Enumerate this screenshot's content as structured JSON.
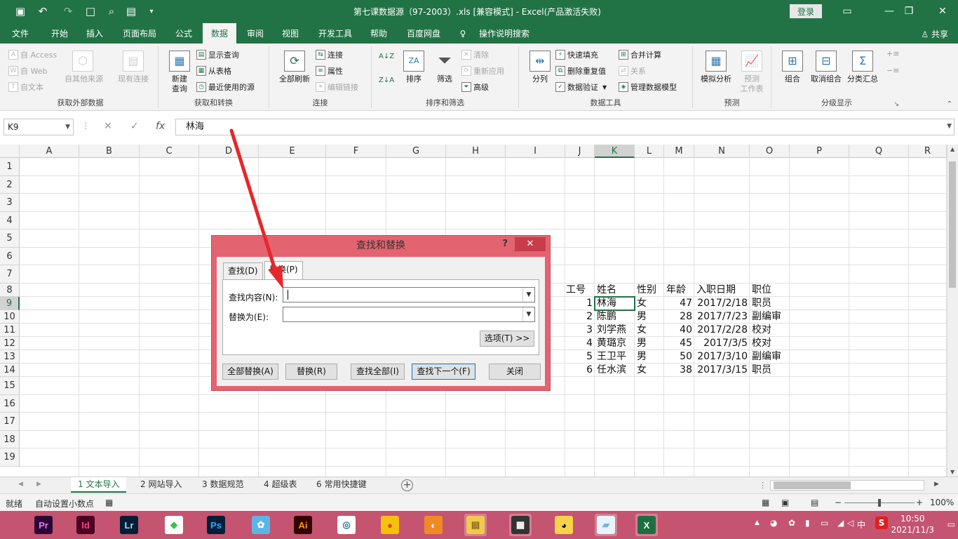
{
  "titlebar": {
    "title": "第七课数据源（97-2003）.xls  [兼容模式]  -  Excel(产品激活失败)",
    "login": "登录",
    "colors": {
      "bg": "#217346"
    }
  },
  "tabs": [
    {
      "label": "文件"
    },
    {
      "label": "开始"
    },
    {
      "label": "插入"
    },
    {
      "label": "页面布局"
    },
    {
      "label": "公式"
    },
    {
      "label": "数据"
    },
    {
      "label": "审阅"
    },
    {
      "label": "视图"
    },
    {
      "label": "开发工具"
    },
    {
      "label": "帮助"
    },
    {
      "label": "百度网盘"
    },
    {
      "label": "操作说明搜索"
    }
  ],
  "share": "共享",
  "ribbon": {
    "get_external": {
      "label": "获取外部数据",
      "access": "自 Access",
      "web": "自 Web",
      "text": "自文本",
      "other": "自其他来源",
      "existing": "现有连接"
    },
    "get_transform": {
      "label": "获取和转换",
      "new_query_1": "新建",
      "new_query_2": "查询",
      "show_query": "显示查询",
      "from_table": "从表格",
      "recent": "最近使用的源"
    },
    "connections": {
      "label": "连接",
      "refresh_all": "全部刷新",
      "connections": "连接",
      "properties": "属性",
      "edit_links": "编辑链接"
    },
    "sort_filter": {
      "label": "排序和筛选",
      "sort": "排序",
      "filter": "筛选",
      "clear": "清除",
      "reapply": "重新应用",
      "advanced": "高级"
    },
    "data_tools": {
      "label": "数据工具",
      "split": "分列",
      "flash_fill": "快速填充",
      "remove_dup": "删除重复值",
      "validation": "数据验证",
      "consolidate": "合并计算",
      "relations": "关系",
      "data_model": "管理数据模型"
    },
    "forecast": {
      "label": "预测",
      "whatif": "模拟分析",
      "sheet_1": "预测",
      "sheet_2": "工作表"
    },
    "outline": {
      "label": "分级显示",
      "group": "组合",
      "ungroup": "取消组合",
      "subtotal": "分类汇总"
    }
  },
  "formula_bar": {
    "name_box": "K9",
    "value": "林海"
  },
  "columns": [
    "A",
    "B",
    "C",
    "D",
    "E",
    "F",
    "G",
    "H",
    "I",
    "J",
    "K",
    "L",
    "M",
    "N",
    "O",
    "P",
    "Q",
    "R"
  ],
  "rows": [
    "1",
    "2",
    "3",
    "4",
    "5",
    "6",
    "7",
    "8",
    "9",
    "10",
    "11",
    "12",
    "13",
    "14",
    "15",
    "16",
    "17",
    "18",
    "19"
  ],
  "table": {
    "headers": [
      "工号",
      "姓名",
      "性别",
      "年龄",
      "入职日期",
      "职位"
    ],
    "rows": [
      [
        "1",
        "林海",
        "女",
        "47",
        "2017/2/18",
        "职员"
      ],
      [
        "2",
        "陈鹏",
        "男",
        "28",
        "2017/7/23",
        "副编审"
      ],
      [
        "3",
        "刘学燕",
        "女",
        "40",
        "2017/2/28",
        "校对"
      ],
      [
        "4",
        "黄璐京",
        "男",
        "45",
        "2017/3/5",
        "校对"
      ],
      [
        "5",
        "王卫平",
        "男",
        "50",
        "2017/3/10",
        "副编审"
      ],
      [
        "6",
        "任水滨",
        "女",
        "38",
        "2017/3/15",
        "职员"
      ]
    ]
  },
  "sheets": [
    "1 文本导入",
    "2 网站导入",
    "3 数据规范",
    "4 超级表",
    "6 常用快捷键"
  ],
  "statusbar": {
    "ready": "就绪",
    "auto_decimal": "自动设置小数点",
    "zoom": "100%"
  },
  "dialog": {
    "title": "查找和替换",
    "help": "?",
    "tab_find": "查找(D)",
    "tab_replace": "替换(P)",
    "find_label": "查找内容(N):",
    "replace_label": "替换为(E):",
    "find_value": "",
    "replace_value": "",
    "options": "选项(T) >>",
    "replace_all": "全部替换(A)",
    "replace": "替换(R)",
    "find_all": "查找全部(I)",
    "find_next": "查找下一个(F)",
    "close": "关闭"
  },
  "taskbar": {
    "apps": [
      {
        "icon": "premiere-icon",
        "glyph": "Pr",
        "fg": "#ea77ff",
        "bg": "#2a0634"
      },
      {
        "icon": "indesign-icon",
        "glyph": "Id",
        "fg": "#ff3f94",
        "bg": "#49021f"
      },
      {
        "icon": "lightroom-icon",
        "glyph": "Lr",
        "fg": "#add5ec",
        "bg": "#001e36"
      },
      {
        "icon": "colorful-app-icon",
        "glyph": "◆",
        "fg": "#3cbf4a",
        "bg": "#ffffff"
      },
      {
        "icon": "photoshop-icon",
        "glyph": "Ps",
        "fg": "#31a8ff",
        "bg": "#001e36"
      },
      {
        "icon": "bird-app-icon",
        "glyph": "✿",
        "fg": "#ffffff",
        "bg": "#5bb6e6"
      },
      {
        "icon": "illustrator-icon",
        "glyph": "Ai",
        "fg": "#ff9a00",
        "bg": "#330000"
      },
      {
        "icon": "browser-icon",
        "glyph": "◎",
        "fg": "#2a6ad8",
        "bg": "#ffffff"
      },
      {
        "icon": "chrome-icon",
        "glyph": "●",
        "fg": "#db4437",
        "bg": "#f4c20d"
      },
      {
        "icon": "orange-app-icon",
        "glyph": "◐",
        "fg": "#ffffff",
        "bg": "#f08a24"
      },
      {
        "icon": "file-explorer-icon",
        "glyph": "▤",
        "fg": "#8a6a1c",
        "bg": "#f2c94c"
      },
      {
        "icon": "video-editor-icon",
        "glyph": "▦",
        "fg": "#ffffff",
        "bg": "#333333"
      },
      {
        "icon": "qq-icon",
        "glyph": "◕",
        "fg": "#111111",
        "bg": "#f7d34a"
      },
      {
        "icon": "notes-app-icon",
        "glyph": "▰",
        "fg": "#6fb3e0",
        "bg": "#e8f3fb"
      },
      {
        "icon": "excel-icon",
        "glyph": "X",
        "fg": "#ffffff",
        "bg": "#1d6f42"
      }
    ],
    "ime": "中",
    "time": "10:50",
    "date": "2021/11/3"
  }
}
